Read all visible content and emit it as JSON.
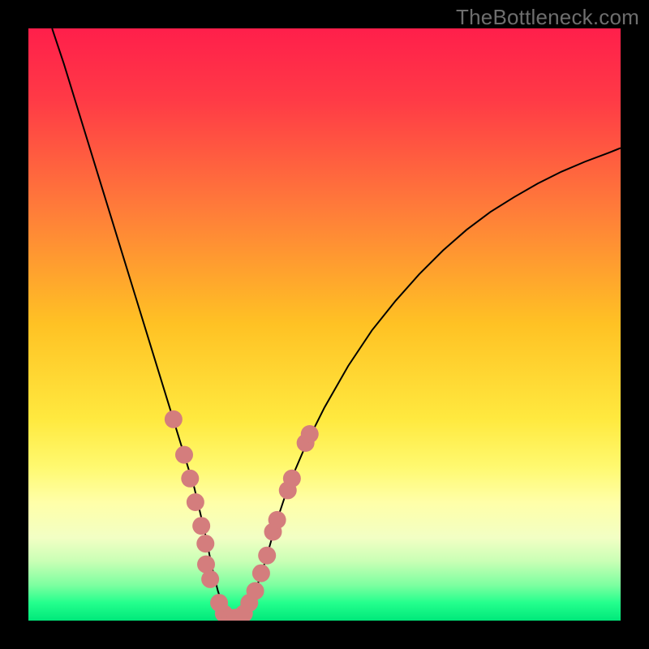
{
  "watermark": "TheBottleneck.com",
  "chart_data": {
    "type": "line",
    "title": "",
    "xlabel": "",
    "ylabel": "",
    "xlim": [
      0,
      100
    ],
    "ylim": [
      0,
      100
    ],
    "background_gradient_stops": [
      {
        "pct": 0,
        "color": "#ff1f4b"
      },
      {
        "pct": 12,
        "color": "#ff3a46"
      },
      {
        "pct": 30,
        "color": "#ff7a3a"
      },
      {
        "pct": 50,
        "color": "#ffc224"
      },
      {
        "pct": 66,
        "color": "#ffe93f"
      },
      {
        "pct": 74,
        "color": "#fff96f"
      },
      {
        "pct": 80,
        "color": "#ffffa8"
      },
      {
        "pct": 86,
        "color": "#f2ffc4"
      },
      {
        "pct": 90,
        "color": "#c9ffb5"
      },
      {
        "pct": 94,
        "color": "#7dffa0"
      },
      {
        "pct": 97,
        "color": "#24ff8d"
      },
      {
        "pct": 100,
        "color": "#00e87a"
      }
    ],
    "series": [
      {
        "name": "bottleneck-curve",
        "color": "#000000",
        "stroke_width": 2,
        "x": [
          4,
          6,
          8,
          10,
          12,
          14,
          16,
          18,
          20,
          22,
          24,
          26,
          28,
          30,
          31,
          32,
          33,
          34,
          35,
          36,
          38,
          40,
          42,
          44,
          47,
          50,
          54,
          58,
          62,
          66,
          70,
          74,
          78,
          82,
          86,
          90,
          94,
          98,
          100
        ],
        "y": [
          100,
          94,
          87.5,
          81,
          74.5,
          68,
          61.5,
          55,
          48.5,
          42,
          35.5,
          29,
          22.5,
          14,
          9,
          5,
          2,
          0.5,
          0.5,
          0.8,
          4,
          10,
          17,
          23,
          30,
          36,
          43,
          49,
          54,
          58.5,
          62.5,
          66,
          69,
          71.5,
          73.8,
          75.8,
          77.5,
          79,
          79.8
        ]
      }
    ],
    "markers": {
      "name": "highlight-dots",
      "color": "#d47d7d",
      "radius": 11,
      "points": [
        {
          "x": 24.5,
          "y": 34
        },
        {
          "x": 26.3,
          "y": 28
        },
        {
          "x": 27.3,
          "y": 24
        },
        {
          "x": 28.2,
          "y": 20
        },
        {
          "x": 29.2,
          "y": 16
        },
        {
          "x": 29.9,
          "y": 13
        },
        {
          "x": 30.0,
          "y": 9.5
        },
        {
          "x": 30.7,
          "y": 7
        },
        {
          "x": 32.2,
          "y": 3
        },
        {
          "x": 33.0,
          "y": 1.2
        },
        {
          "x": 34.0,
          "y": 0.5
        },
        {
          "x": 35.0,
          "y": 0.5
        },
        {
          "x": 36.4,
          "y": 1.2
        },
        {
          "x": 37.3,
          "y": 3
        },
        {
          "x": 38.3,
          "y": 5
        },
        {
          "x": 39.3,
          "y": 8
        },
        {
          "x": 40.3,
          "y": 11
        },
        {
          "x": 41.3,
          "y": 15
        },
        {
          "x": 42.0,
          "y": 17
        },
        {
          "x": 43.8,
          "y": 22
        },
        {
          "x": 44.5,
          "y": 24
        },
        {
          "x": 46.8,
          "y": 30
        },
        {
          "x": 47.5,
          "y": 31.5
        }
      ]
    }
  }
}
